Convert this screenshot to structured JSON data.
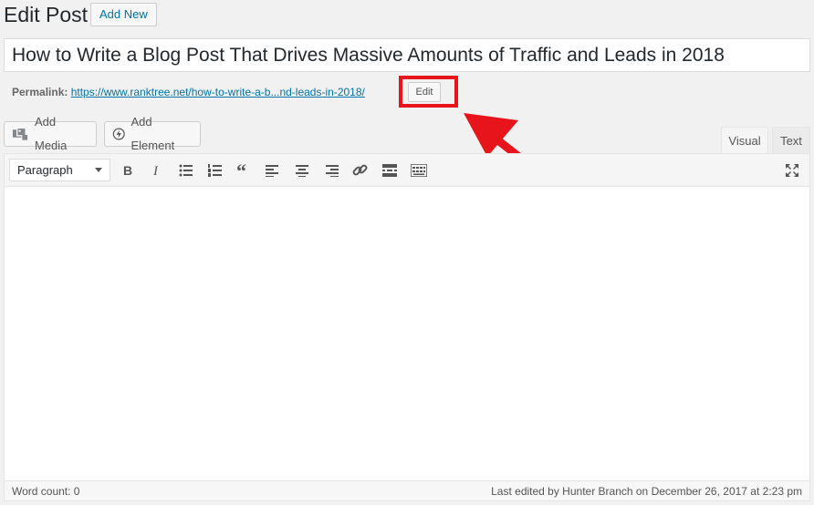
{
  "header": {
    "title": "Edit Post",
    "add_new_label": "Add New"
  },
  "post": {
    "title": "How to Write a Blog Post That Drives Massive Amounts of Traffic and Leads in 2018"
  },
  "permalink": {
    "label": "Permalink:",
    "url_text": "https://www.ranktree.net/how-to-write-a-b...nd-leads-in-2018/",
    "edit_label": "Edit"
  },
  "media_buttons": {
    "add_media": "Add Media",
    "add_element": "Add Element"
  },
  "tabs": [
    {
      "label": "Visual",
      "active": true
    },
    {
      "label": "Text",
      "active": false
    }
  ],
  "toolbar": {
    "format_selected": "Paragraph",
    "icons": [
      "bold-icon",
      "italic-icon",
      "bullet-list-icon",
      "numbered-list-icon",
      "blockquote-icon",
      "align-left-icon",
      "align-center-icon",
      "align-right-icon",
      "link-icon",
      "read-more-icon",
      "toolbar-toggle-icon",
      "fullscreen-icon"
    ]
  },
  "status": {
    "word_count": "Word count: 0",
    "last_edited": "Last edited by Hunter Branch on December 26, 2017 at 2:23 pm"
  },
  "colors": {
    "link": "#0073aa",
    "highlight": "#e8141c",
    "arrow": "#e8141c"
  }
}
